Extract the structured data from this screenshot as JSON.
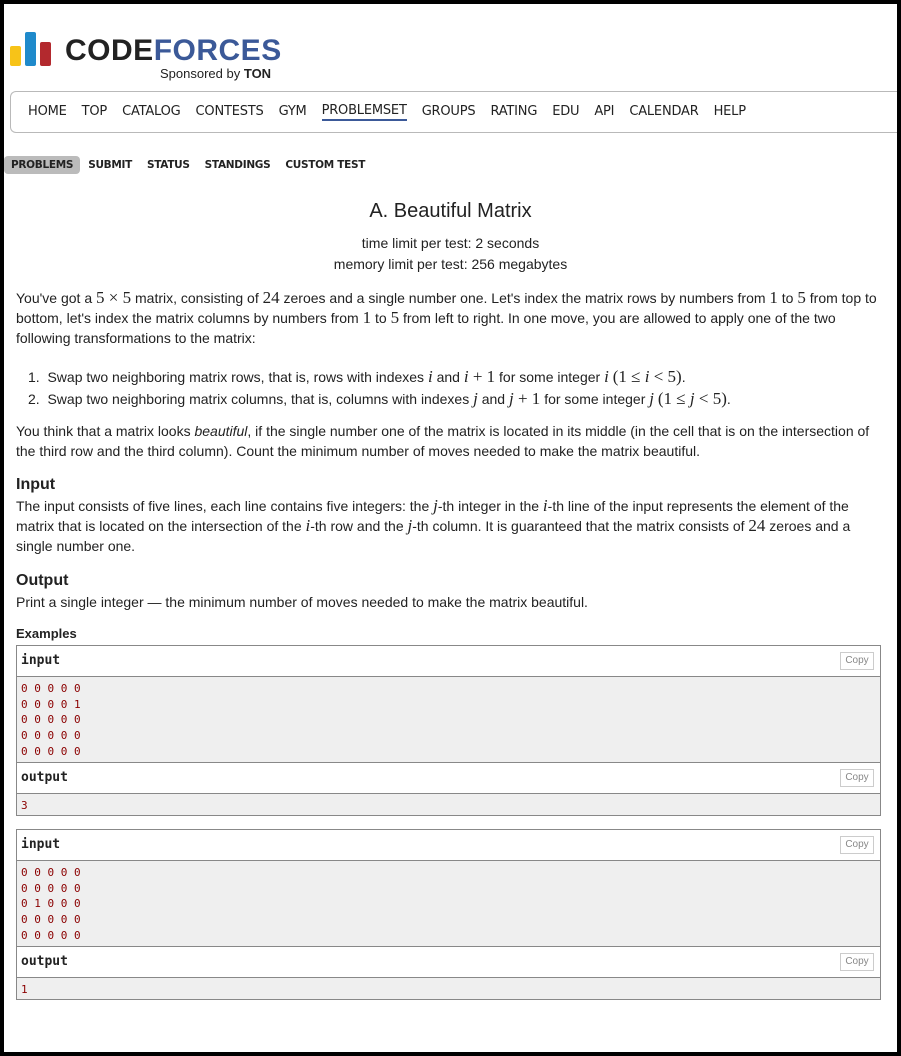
{
  "logo": {
    "code": "CODE",
    "forces": "FORCES",
    "sponsored": "Sponsored by",
    "sponsor": "TON"
  },
  "menu": [
    "HOME",
    "TOP",
    "CATALOG",
    "CONTESTS",
    "GYM",
    "PROBLEMSET",
    "GROUPS",
    "RATING",
    "EDU",
    "API",
    "CALENDAR",
    "HELP"
  ],
  "menu_active": "PROBLEMSET",
  "subtabs": [
    "PROBLEMS",
    "SUBMIT",
    "STATUS",
    "STANDINGS",
    "CUSTOM TEST"
  ],
  "problem": {
    "title": "A. Beautiful Matrix",
    "time_limit": "time limit per test: 2 seconds",
    "memory_limit": "memory limit per test: 256 megabytes",
    "input_header": "Input",
    "output_header": "Output",
    "output_text": "Print a single integer — the minimum number of moves needed to make the matrix beautiful.",
    "examples_header": "Examples"
  },
  "examples": [
    {
      "input_label": "input",
      "input": [
        "0 0 0 0 0",
        "0 0 0 0 1",
        "0 0 0 0 0",
        "0 0 0 0 0",
        "0 0 0 0 0"
      ],
      "output_label": "output",
      "output": "3",
      "copy": "Copy"
    },
    {
      "input_label": "input",
      "input": [
        "0 0 0 0 0",
        "0 0 0 0 0",
        "0 1 0 0 0",
        "0 0 0 0 0",
        "0 0 0 0 0"
      ],
      "output_label": "output",
      "output": "1",
      "copy": "Copy"
    }
  ]
}
